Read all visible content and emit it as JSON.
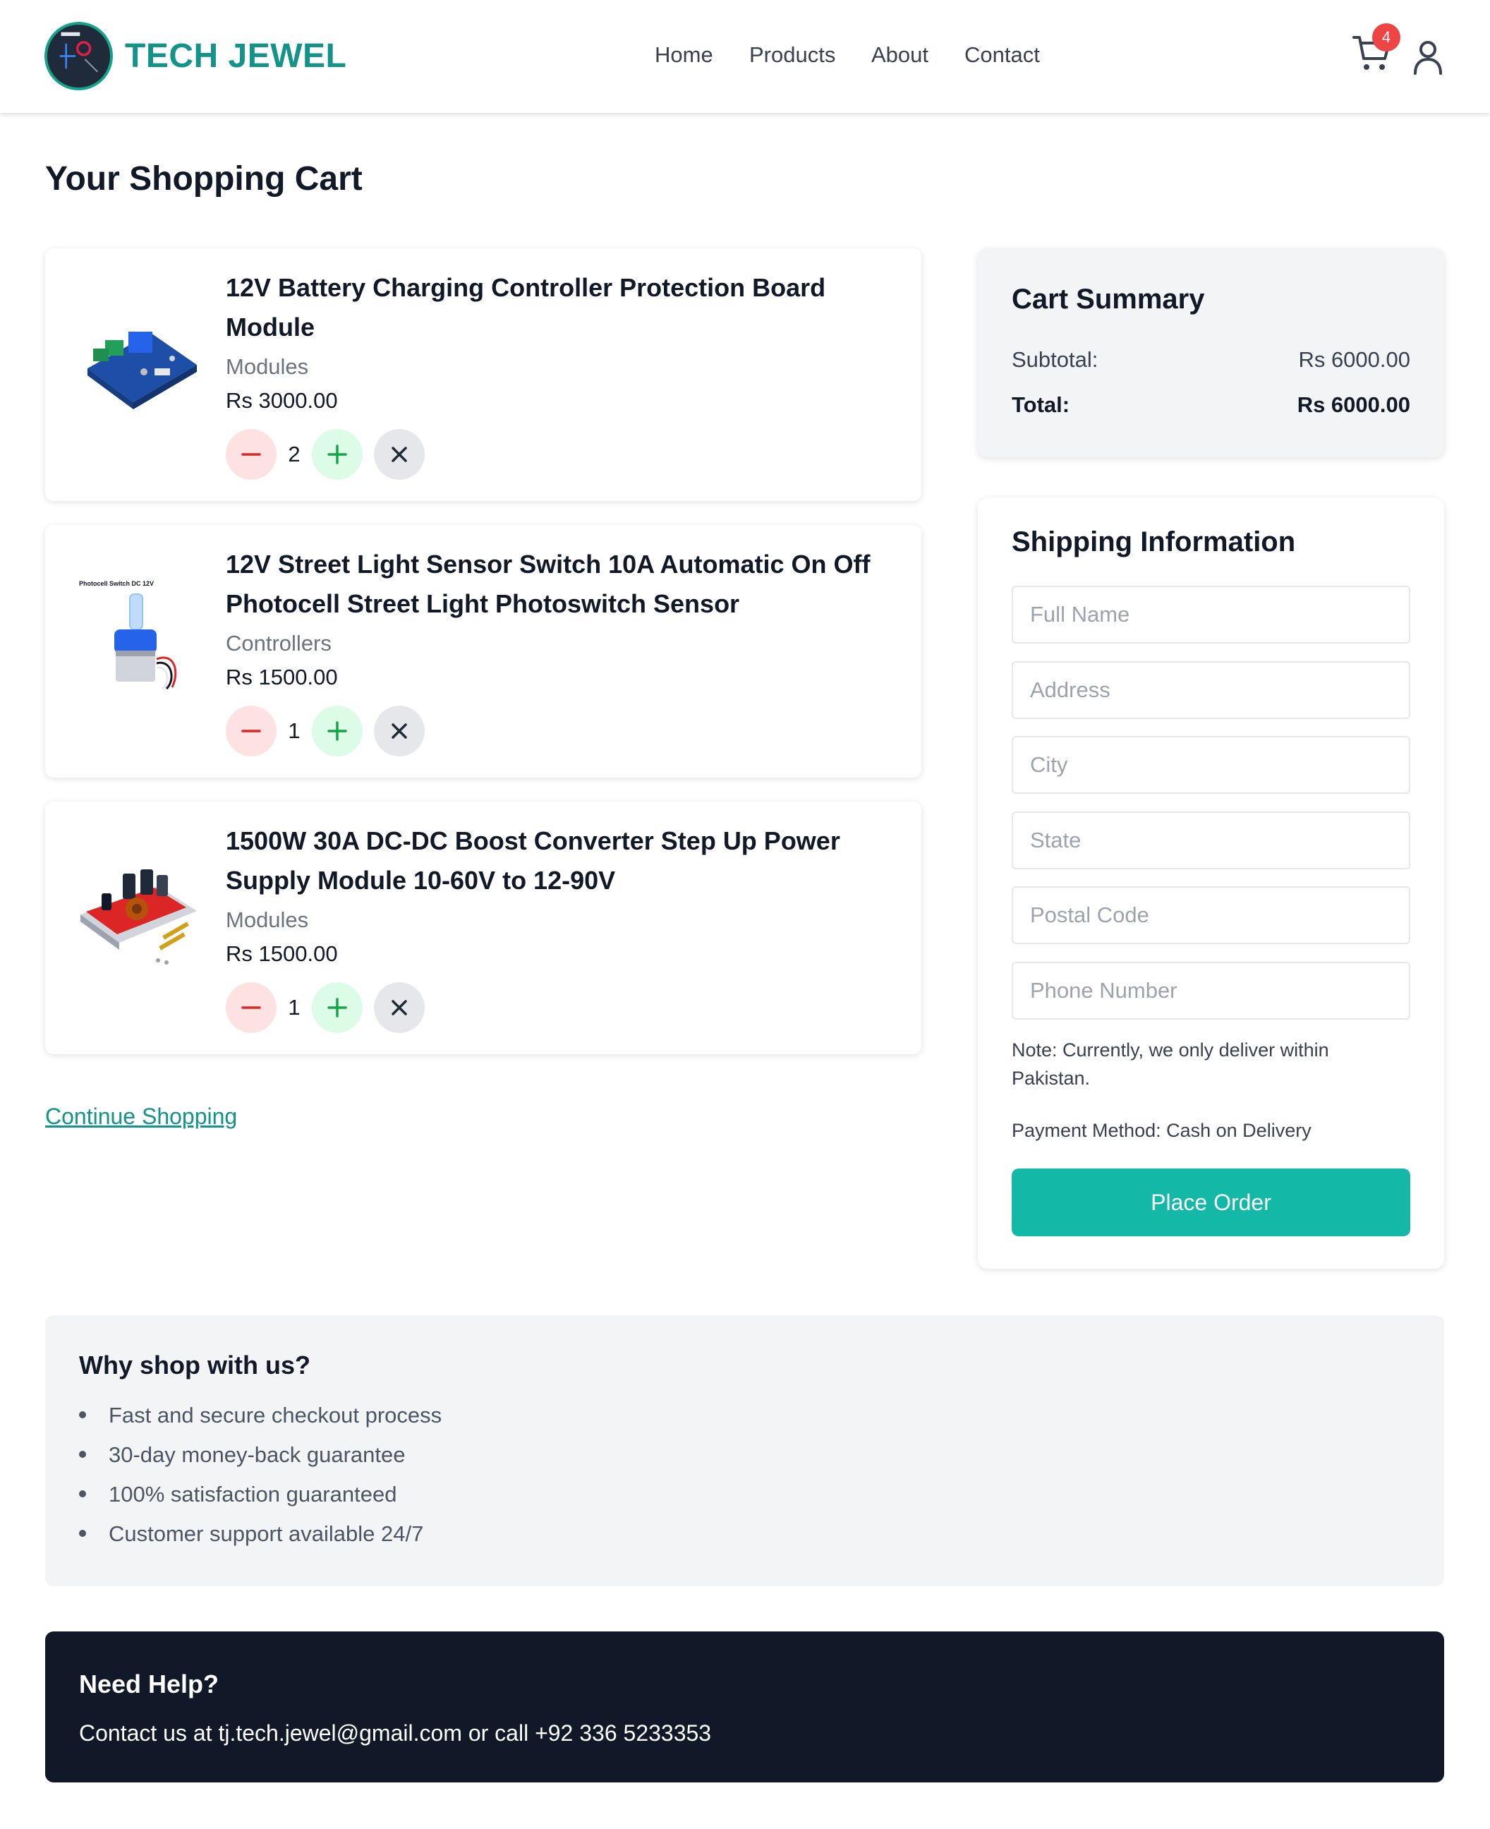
{
  "header": {
    "brand": "TECH JEWEL",
    "nav": [
      "Home",
      "Products",
      "About",
      "Contact"
    ],
    "cart_count": "4"
  },
  "page_title": "Your Shopping Cart",
  "cart_items": [
    {
      "name": "12V Battery Charging Controller Protection Board Module",
      "category": "Modules",
      "price": "Rs 3000.00",
      "quantity": "2"
    },
    {
      "name": "12V Street Light Sensor Switch 10A Automatic On Off Photocell Street Light Photoswitch Sensor",
      "category": "Controllers",
      "price": "Rs 1500.00",
      "quantity": "1",
      "image_caption": "Photocell Switch DC 12V"
    },
    {
      "name": "1500W 30A DC-DC Boost Converter Step Up Power Supply Module 10-60V to 12-90V",
      "category": "Modules",
      "price": "Rs 1500.00",
      "quantity": "1"
    }
  ],
  "continue_shopping": "Continue Shopping",
  "summary": {
    "title": "Cart Summary",
    "subtotal_label": "Subtotal:",
    "subtotal_value": "Rs 6000.00",
    "total_label": "Total:",
    "total_value": "Rs 6000.00"
  },
  "shipping": {
    "title": "Shipping Information",
    "fields": [
      {
        "placeholder": "Full Name",
        "value": ""
      },
      {
        "placeholder": "Address",
        "value": ""
      },
      {
        "placeholder": "City",
        "value": ""
      },
      {
        "placeholder": "State",
        "value": ""
      },
      {
        "placeholder": "Postal Code",
        "value": ""
      },
      {
        "placeholder": "Phone Number",
        "value": ""
      }
    ],
    "note": "Note: Currently, we only deliver within Pakistan.",
    "payment": "Payment Method: Cash on Delivery",
    "button": "Place Order"
  },
  "why": {
    "title": "Why shop with us?",
    "items": [
      "Fast and secure checkout process",
      "30-day money-back guarantee",
      "100% satisfaction guaranteed",
      "Customer support available 24/7"
    ]
  },
  "help": {
    "title": "Need Help?",
    "text": "Contact us at tj.tech.jewel@gmail.com or call +92 336 5233353"
  },
  "colors": {
    "brand": "#14938a",
    "button": "#14b8a6",
    "badge": "#ef4444",
    "footer_bg": "#111827"
  },
  "icons": [
    "logo-icon",
    "cart-icon",
    "user-icon",
    "minus-icon",
    "plus-icon",
    "close-icon"
  ]
}
